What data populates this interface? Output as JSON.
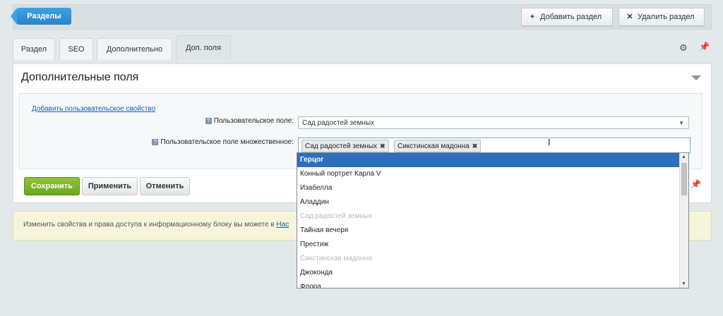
{
  "toolbar": {
    "sections_label": "Разделы",
    "add_section_label": "Добавить раздел",
    "delete_section_label": "Удалить раздел"
  },
  "tabs": [
    {
      "label": "Раздел"
    },
    {
      "label": "SEO"
    },
    {
      "label": "Дополнительно"
    },
    {
      "label": "Доп. поля"
    }
  ],
  "panel": {
    "title": "Дополнительные поля",
    "add_property_link": "Добавить пользовательское свойство",
    "field1_label": "Пользовательское поле:",
    "field1_value": "Сад радостей земных",
    "field2_label": "Пользовательское поле множественное:",
    "field2_chips": [
      "Сад радостей земных",
      "Сикстинская мадонна"
    ]
  },
  "actions": {
    "save_label": "Сохранить",
    "apply_label": "Применить",
    "cancel_label": "Отменить"
  },
  "info": {
    "text": "Изменить свойства и права доступа к информационному блоку вы можете в ",
    "link": "Нас"
  },
  "dropdown": {
    "options": [
      {
        "label": "Герцог",
        "state": "selected"
      },
      {
        "label": "Конный портрет Карла V",
        "state": "normal"
      },
      {
        "label": "Изабелла",
        "state": "normal"
      },
      {
        "label": "Аладдин",
        "state": "normal"
      },
      {
        "label": "Сад радостей земных",
        "state": "disabled"
      },
      {
        "label": "Тайная вечеря",
        "state": "normal"
      },
      {
        "label": "Престиж",
        "state": "normal"
      },
      {
        "label": "Сикстинская мадонна",
        "state": "disabled"
      },
      {
        "label": "Джоконда",
        "state": "normal"
      },
      {
        "label": "Флора",
        "state": "normal"
      }
    ]
  },
  "colors": {
    "accent_blue": "#2b83c8",
    "save_green": "#7ab52a",
    "selected_option": "#2e6fbd"
  }
}
